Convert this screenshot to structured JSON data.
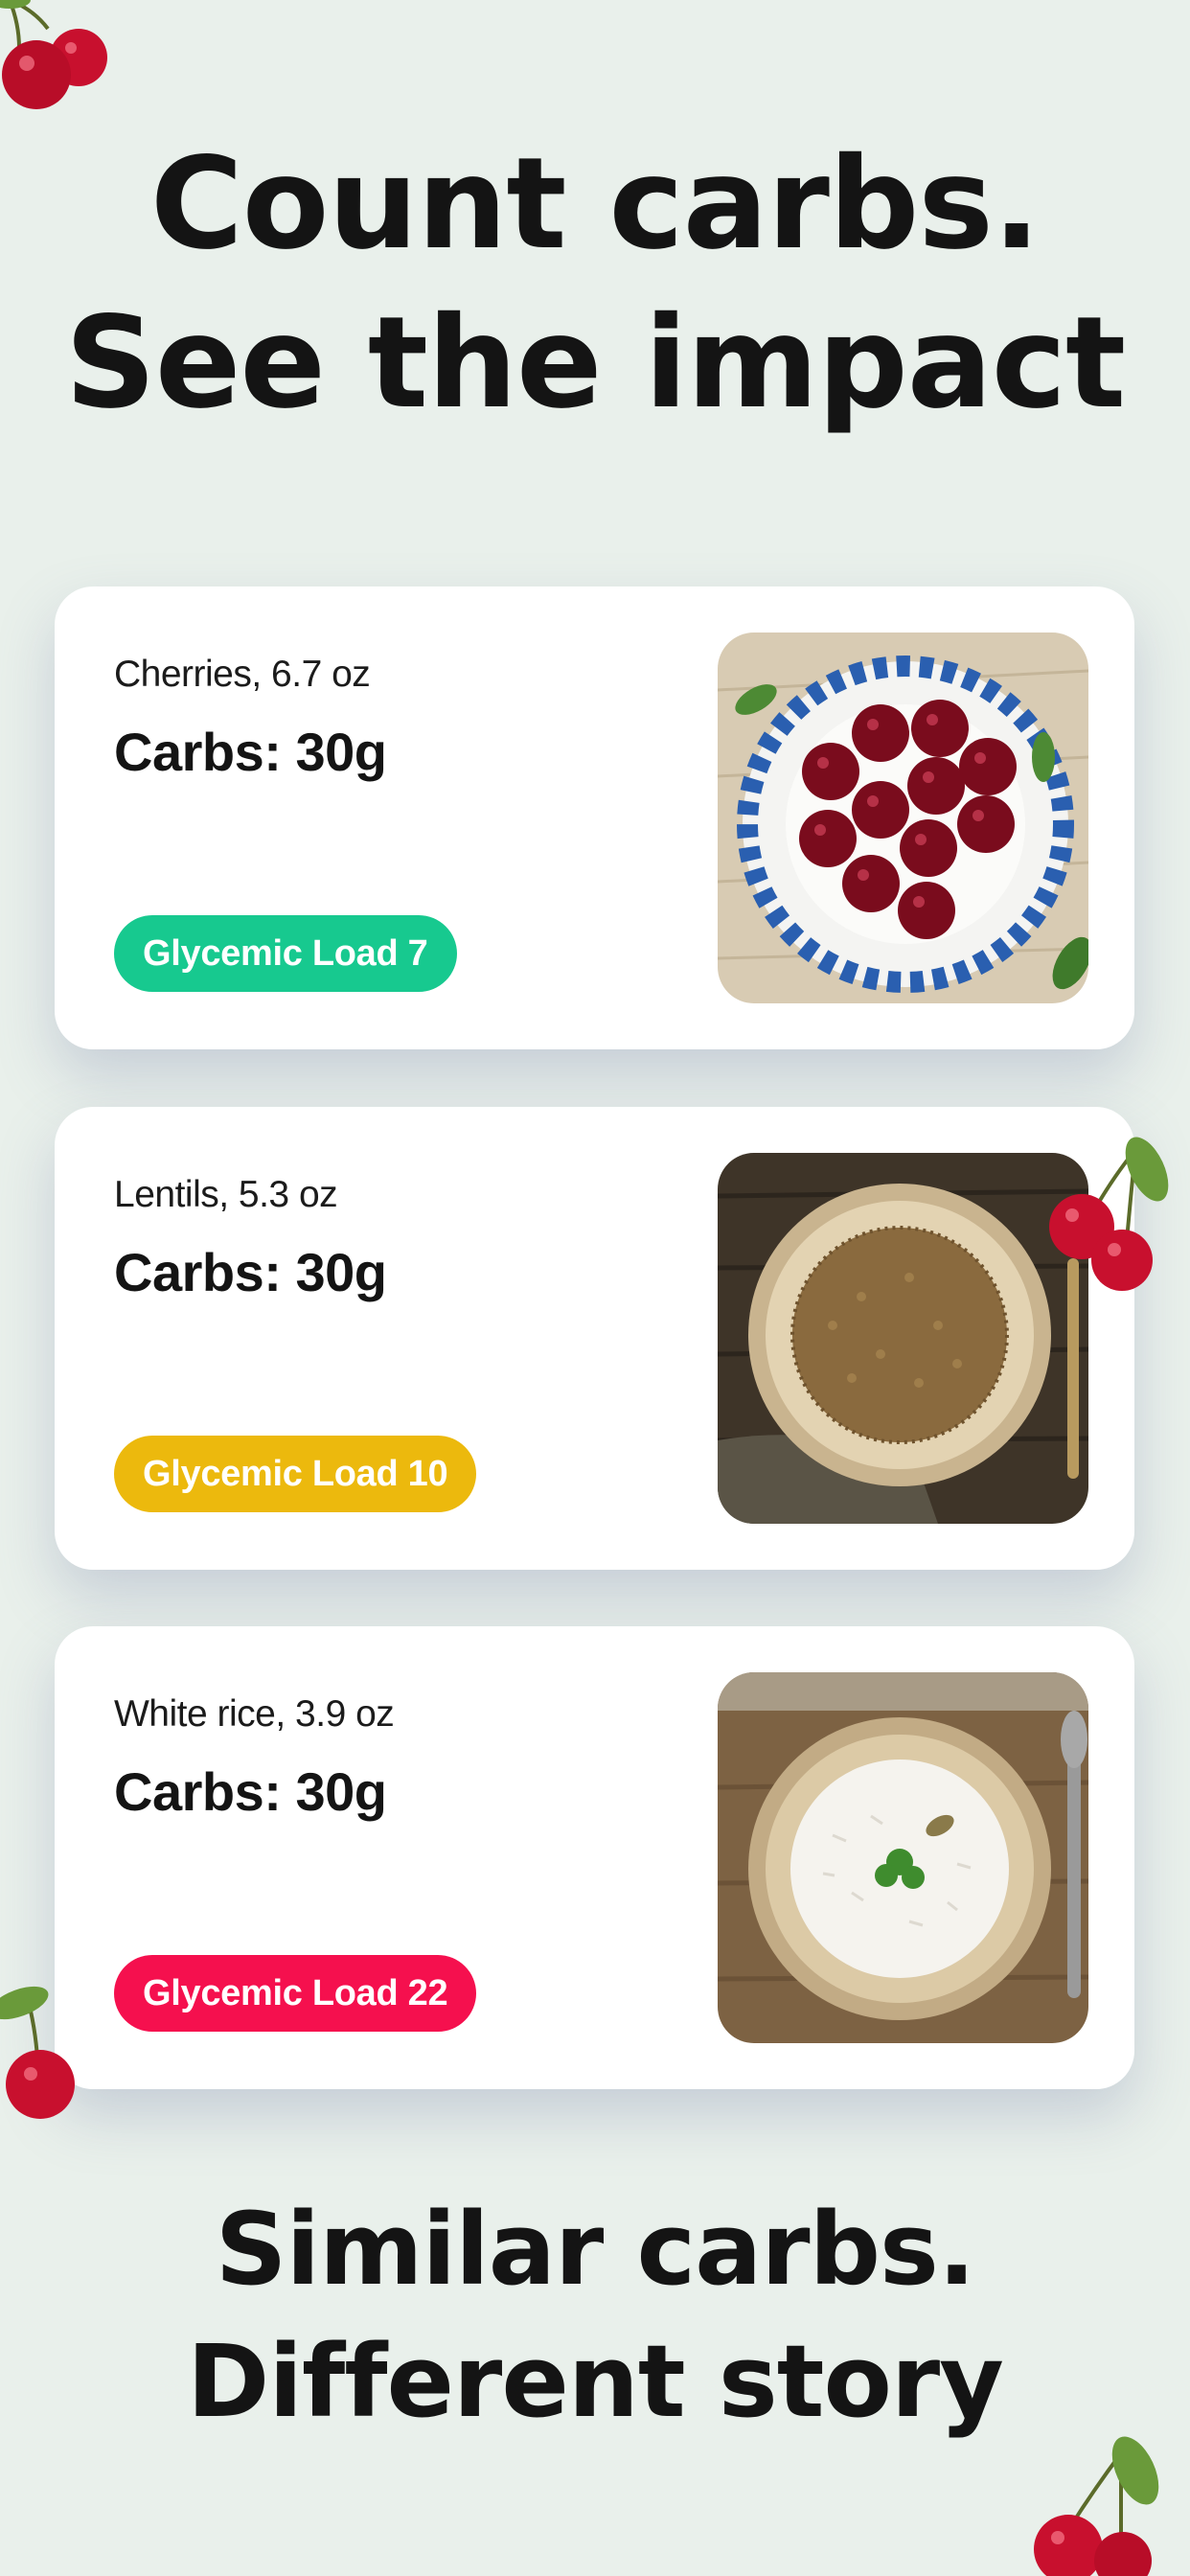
{
  "headline_top": [
    "Count carbs.",
    "See the impact"
  ],
  "cards": [
    {
      "subtitle": "Cherries, 6.7 oz",
      "carbs": "Carbs: 30g",
      "badge": "Glycemic Load 7",
      "badge_color": "#17c98f",
      "photo": "cherries-plate-photo"
    },
    {
      "subtitle": "Lentils,  5.3 oz",
      "carbs": "Carbs: 30g",
      "badge": "Glycemic Load 10",
      "badge_color": "#ecb90d",
      "photo": "lentils-bowl-photo"
    },
    {
      "subtitle": "White rice, 3.9 oz",
      "carbs": "Carbs: 30g",
      "badge": "Glycemic Load 22",
      "badge_color": "#f5104e",
      "photo": "rice-bowl-photo"
    }
  ],
  "headline_bottom": [
    "Similar carbs.",
    "Different story"
  ],
  "colors": {
    "background": "#e9f0eb",
    "card": "#ffffff",
    "text": "#141414",
    "cherry": "#c8102e"
  },
  "icons": [
    "cherry-icon"
  ]
}
